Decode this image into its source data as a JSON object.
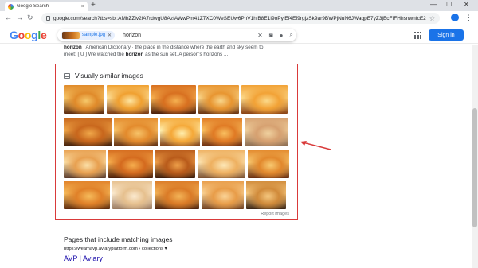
{
  "browser": {
    "tab_title": "Google Search",
    "tab_close": "×",
    "new_tab": "+",
    "url": "google.com/search?tbs=sbi:AMhZZiv2lA7rdwgU8AzfAWwPm41Z7XC0WeSEUw6PnV1hjB8E1I9oPyjEf4Ef9rgjzSk9ar9BWPjNuN6JWagpE7yZ3jEcFfFHhsnwnfcE2H4WdM1WWxVayi...",
    "window_controls": {
      "min": "—",
      "max": "☐",
      "close": "✕"
    },
    "nav": {
      "back": "←",
      "forward": "→",
      "reload": "↻"
    }
  },
  "google": {
    "logo": [
      {
        "ch": "G",
        "color": "#4285f4"
      },
      {
        "ch": "o",
        "color": "#ea4335"
      },
      {
        "ch": "o",
        "color": "#fbbc05"
      },
      {
        "ch": "g",
        "color": "#4285f4"
      },
      {
        "ch": "l",
        "color": "#34a853"
      },
      {
        "ch": "e",
        "color": "#ea4335"
      }
    ],
    "chip_filename": "sample.jpg",
    "query": "horizon",
    "signin_label": "Sign in",
    "accent": "#1a73e8"
  },
  "snippet": {
    "bold1": "horizon",
    "text1": " | American Dictionary · the place in the distance where the earth and sky seem to",
    "text2a": "meet: [ U ] We watched the ",
    "bold2": "horizon",
    "text2b": " as the sun set. A person's horizons ..."
  },
  "similar": {
    "title": "Visually similar images",
    "report_label": "Report images",
    "highlight_color": "#d93a3a",
    "rows": [
      [
        {
          "w": 51,
          "c1": "#5a2a10",
          "c2": "#e08a2a",
          "c3": "#f6c86a"
        },
        {
          "w": 53,
          "c1": "#7a3a12",
          "c2": "#f0a030",
          "c3": "#fde4a0"
        },
        {
          "w": 56,
          "c1": "#4a1e0a",
          "c2": "#d87020",
          "c3": "#f5b050"
        },
        {
          "w": 51,
          "c1": "#6a3412",
          "c2": "#e89530",
          "c3": "#f8d58a"
        },
        {
          "w": 58,
          "c1": "#8a4214",
          "c2": "#f2a236",
          "c3": "#fbd98a"
        }
      ],
      [
        {
          "w": 60,
          "c1": "#3e1a08",
          "c2": "#c8661c",
          "c3": "#f0a84a"
        },
        {
          "w": 55,
          "c1": "#5e2c10",
          "c2": "#e38a2c",
          "c3": "#f7c46a"
        },
        {
          "w": 50,
          "c1": "#7e3e14",
          "c2": "#f5a838",
          "c3": "#fff0b0"
        },
        {
          "w": 50,
          "c1": "#6a2a0e",
          "c2": "#e07a24",
          "c3": "#f9c060"
        },
        {
          "w": 54,
          "c1": "#8a6a50",
          "c2": "#d6a070",
          "c3": "#f0d2a0"
        }
      ],
      [
        {
          "w": 53,
          "c1": "#5a3a2a",
          "c2": "#e8a050",
          "c3": "#fbe0a8"
        },
        {
          "w": 56,
          "c1": "#4a1c08",
          "c2": "#d46a1e",
          "c3": "#f6ae4e"
        },
        {
          "w": 50,
          "c1": "#3a1a0a",
          "c2": "#b85a1a",
          "c3": "#eea04a"
        },
        {
          "w": 60,
          "c1": "#7a5030",
          "c2": "#eeb060",
          "c3": "#fde8b8"
        },
        {
          "w": 52,
          "c1": "#6a2e10",
          "c2": "#e2882c",
          "c3": "#f8ca72"
        }
      ],
      [
        {
          "w": 58,
          "c1": "#5e2a0c",
          "c2": "#e08028",
          "c3": "#f6bc5c"
        },
        {
          "w": 50,
          "c1": "#9a7a60",
          "c2": "#e6c08e",
          "c3": "#fbead0"
        },
        {
          "w": 56,
          "c1": "#4e220c",
          "c2": "#da7a26",
          "c3": "#f3b458"
        },
        {
          "w": 53,
          "c1": "#704020",
          "c2": "#e89c48",
          "c3": "#fad498"
        },
        {
          "w": 50,
          "c1": "#3a2414",
          "c2": "#d08a3a",
          "c3": "#f5c880"
        }
      ]
    ]
  },
  "pages": {
    "title": "Pages that include matching images",
    "url": "https://weamavp.aviaryplatform.com › collections  ▾",
    "result_title": "AVP | Aviary"
  }
}
